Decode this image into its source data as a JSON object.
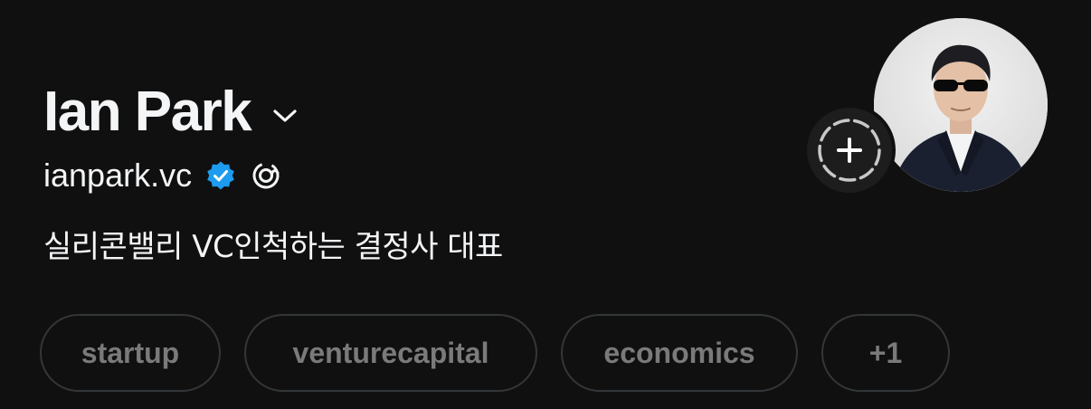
{
  "profile": {
    "name": "Ian Park",
    "handle": "ianpark.vc",
    "bio": "실리콘밸리 VC인척하는 결정사 대표",
    "verified": true,
    "verified_color": "#1d9bf0"
  },
  "tags": [
    {
      "label": "startup"
    },
    {
      "label": "venturecapital"
    },
    {
      "label": "economics"
    },
    {
      "label": "+1"
    }
  ],
  "icons": {
    "name_dropdown": "chevron-down-icon",
    "verified": "verified-badge-icon",
    "threads": "threads-icon",
    "add_story": "add-story-icon"
  },
  "colors": {
    "background": "#101010",
    "text_primary": "#f3f5f7",
    "tag_text": "#7a7a7a",
    "tag_border": "#333638"
  }
}
